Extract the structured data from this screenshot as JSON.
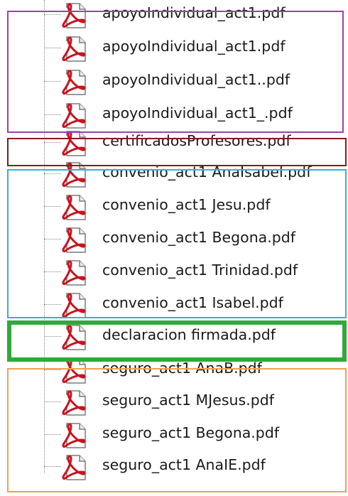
{
  "files": [
    {
      "name": "apoyoIndividual_act1.pdf",
      "icon": "pdf-file-icon"
    },
    {
      "name": "apoyoIndividual_act1.pdf",
      "icon": "pdf-file-icon"
    },
    {
      "name": "apoyoIndividual_act1..pdf",
      "icon": "pdf-file-icon"
    },
    {
      "name": "apoyoIndividual_act1_.pdf",
      "icon": "pdf-file-icon"
    },
    {
      "name": "certificadosProfesores.pdf",
      "icon": "pdf-file-icon"
    },
    {
      "name": "convenio_act1 AnaIsabel.pdf",
      "icon": "pdf-file-icon"
    },
    {
      "name": "convenio_act1 Jesu.pdf",
      "icon": "pdf-file-icon"
    },
    {
      "name": "convenio_act1 Begona.pdf",
      "icon": "pdf-file-icon"
    },
    {
      "name": "convenio_act1 Trinidad.pdf",
      "icon": "pdf-file-icon"
    },
    {
      "name": "convenio_act1 Isabel.pdf",
      "icon": "pdf-file-icon"
    },
    {
      "name": "declaracion firmada.pdf",
      "icon": "pdf-file-icon"
    },
    {
      "name": "seguro_act1 AnaB.pdf",
      "icon": "pdf-file-icon"
    },
    {
      "name": "seguro_act1 MJesus.pdf",
      "icon": "pdf-file-icon"
    },
    {
      "name": "seguro_act1 Begona.pdf",
      "icon": "pdf-file-icon"
    },
    {
      "name": "seguro_act1 AnaIE.pdf",
      "icon": "pdf-file-icon"
    }
  ],
  "group_colors": {
    "apoyo": "#a040b0",
    "certificados": "#8b1a1a",
    "convenio": "#3aaedc",
    "declaracion": "#2eaa3a",
    "seguro": "#f0a050"
  }
}
